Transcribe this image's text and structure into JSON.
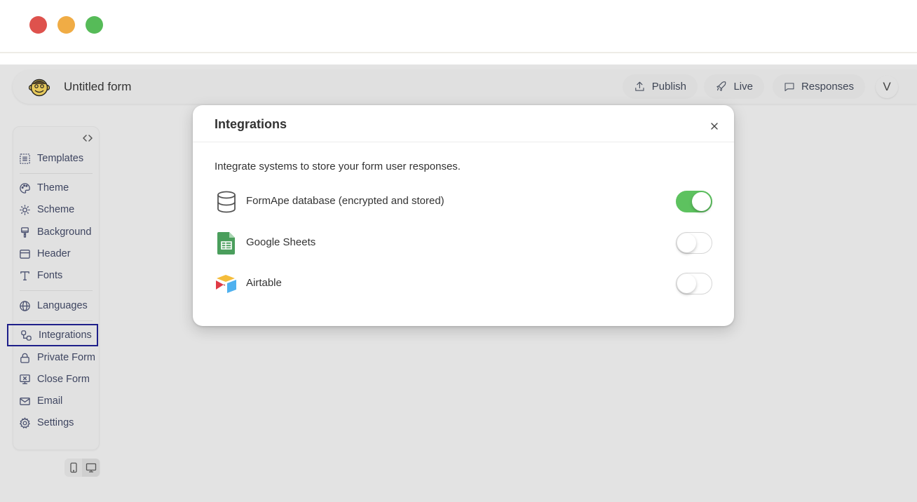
{
  "window": {
    "controls": [
      "close",
      "minimize",
      "maximize"
    ]
  },
  "header": {
    "logo_icon": "monkey-face-icon",
    "form_title": "Untitled form",
    "buttons": {
      "publish": {
        "label": "Publish",
        "icon": "upload-icon"
      },
      "live": {
        "label": "Live",
        "icon": "rocket-icon"
      },
      "responses": {
        "label": "Responses",
        "icon": "chat-bubble-icon"
      }
    },
    "avatar_initial": "V"
  },
  "sidebar": {
    "collapse_icon": "code-brackets-icon",
    "items": [
      {
        "label": "Templates",
        "icon": "templates-icon"
      },
      {
        "label": "Theme",
        "icon": "palette-icon"
      },
      {
        "label": "Scheme",
        "icon": "sun-moon-icon"
      },
      {
        "label": "Background",
        "icon": "paint-brush-icon"
      },
      {
        "label": "Header",
        "icon": "layout-header-icon"
      },
      {
        "label": "Fonts",
        "icon": "type-icon"
      },
      {
        "label": "Languages",
        "icon": "globe-icon"
      },
      {
        "label": "Integrations",
        "icon": "integrations-icon",
        "active": true
      },
      {
        "label": "Private Form",
        "icon": "lock-icon"
      },
      {
        "label": "Close Form",
        "icon": "monitor-x-icon"
      },
      {
        "label": "Email",
        "icon": "mail-icon"
      },
      {
        "label": "Settings",
        "icon": "gear-icon"
      }
    ],
    "device_toggle": {
      "options": [
        "mobile",
        "desktop"
      ],
      "selected": "desktop"
    }
  },
  "modal": {
    "title": "Integrations",
    "description": "Integrate systems to store your form user responses.",
    "integrations": [
      {
        "label": "FormApe database (encrypted and stored)",
        "icon": "database-icon",
        "enabled": true
      },
      {
        "label": "Google Sheets",
        "icon": "google-sheets-icon",
        "enabled": false
      },
      {
        "label": "Airtable",
        "icon": "airtable-icon",
        "enabled": false
      }
    ]
  },
  "colors": {
    "toggle_on": "#5dc25f",
    "active_outline": "#1e1f8a",
    "traffic_red": "#de524d",
    "traffic_yellow": "#f0ac45",
    "traffic_green": "#56bb58"
  }
}
